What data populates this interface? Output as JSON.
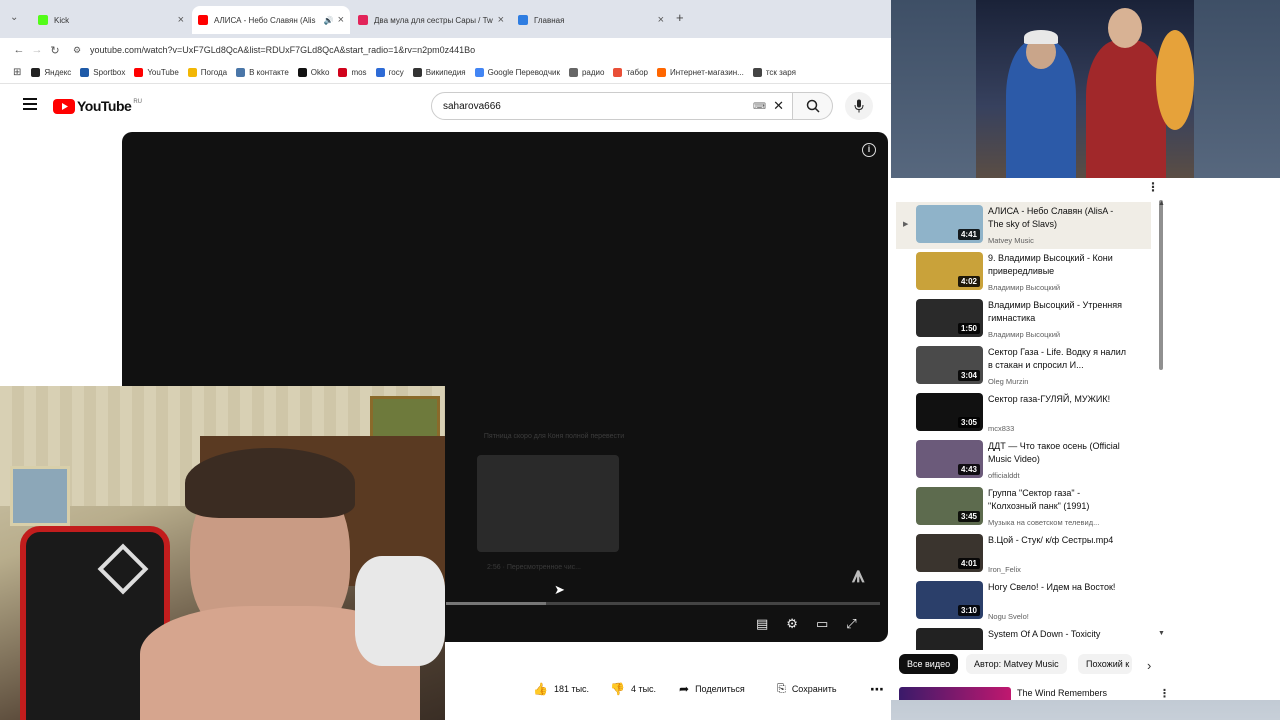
{
  "browser": {
    "tabs": [
      {
        "title": "Kick",
        "color": "#53fc18"
      },
      {
        "title": "АЛИСА - Небо Славян (Alis",
        "color": "#ff0000"
      },
      {
        "title": "Два мула для сестры Сары / Tw",
        "color": "#e2245a"
      },
      {
        "title": "Главная",
        "color": "#2f7de1"
      }
    ],
    "new_tab": "+",
    "url": "youtube.com/watch?v=UxF7GLd8QcA&list=RDUxF7GLd8QcA&start_radio=1&rv=n2pm0z441Bo",
    "bookmarks": [
      {
        "label": "Яндекс",
        "color": "#222"
      },
      {
        "label": "Sportbox",
        "color": "#1e5aa8"
      },
      {
        "label": "YouTube",
        "color": "#ff0000"
      },
      {
        "label": "Погода",
        "color": "#f2b705"
      },
      {
        "label": "В контакте",
        "color": "#4a76a8"
      },
      {
        "label": "Okko",
        "color": "#111"
      },
      {
        "label": "mos",
        "color": "#d0021b"
      },
      {
        "label": "госу",
        "color": "#2e6bd6"
      },
      {
        "label": "Википедия",
        "color": "#333"
      },
      {
        "label": "Google Переводчик",
        "color": "#4285f4"
      },
      {
        "label": "радио",
        "color": "#666"
      },
      {
        "label": "табор",
        "color": "#e94f37"
      },
      {
        "label": "Интернет-магазин...",
        "color": "#ff6600"
      },
      {
        "label": "тск заря",
        "color": "#444"
      }
    ]
  },
  "youtube": {
    "logo": "YouTube",
    "region": "RU",
    "search_value": "saharova666",
    "player_overlay": {
      "next_title": "Пятница скоро для Коня полной перевести",
      "next_caption": "2:56 · Пересмотренное чис..."
    },
    "actions": {
      "likes": "181 тыс.",
      "dislikes": "4 тыс.",
      "share": "Поделиться",
      "save": "Сохранить"
    },
    "playlist": [
      {
        "title": "АЛИСА - Небо Славян (AlisA - The sky of Slavs)",
        "channel": "Matvey Music",
        "duration": "4:41",
        "thumb": "#8fb3c9",
        "active": true
      },
      {
        "title": "9. Владимир Высоцкий - Кони привередливые",
        "channel": "Владимир Высоцкий",
        "duration": "4:02",
        "thumb": "#c9a23a"
      },
      {
        "title": "Владимир Высоцкий - Утренняя гимнастика",
        "channel": "Владимир Высоцкий",
        "duration": "1:50",
        "thumb": "#2a2a2a"
      },
      {
        "title": "Сектор Газа - Life. Водку я налил в стакан и спросил И...",
        "channel": "Oleg Murzin",
        "duration": "3:04",
        "thumb": "#4a4a4a"
      },
      {
        "title": "Сектор газа-ГУЛЯЙ, МУЖИК!",
        "channel": "mcx833",
        "duration": "3:05",
        "thumb": "#111111"
      },
      {
        "title": "ДДТ — Что такое осень (Official Music Video)",
        "channel": "officialddt",
        "duration": "4:43",
        "thumb": "#6b5a7a"
      },
      {
        "title": "Группа \"Сектор газа\" - \"Колхозный панк\" (1991)",
        "channel": "Музыка на советском телевид...",
        "duration": "3:45",
        "thumb": "#5d6b4e"
      },
      {
        "title": "В.Цой - Стук/ к/ф Сестры.mp4",
        "channel": "Iron_Felix",
        "duration": "4:01",
        "thumb": "#3a342e"
      },
      {
        "title": "Ногу Свело! - Идем на Восток!",
        "channel": "Nogu Svelo!",
        "duration": "3:10",
        "thumb": "#2b3f6a"
      },
      {
        "title": "System Of A Down - Toxicity",
        "channel": "",
        "duration": "",
        "thumb": "#222222"
      }
    ],
    "chips": [
      "Все видео",
      "Автор: Matvey Music",
      "Похожий к"
    ],
    "next_rec": {
      "title": "The Wind Remembers"
    }
  }
}
